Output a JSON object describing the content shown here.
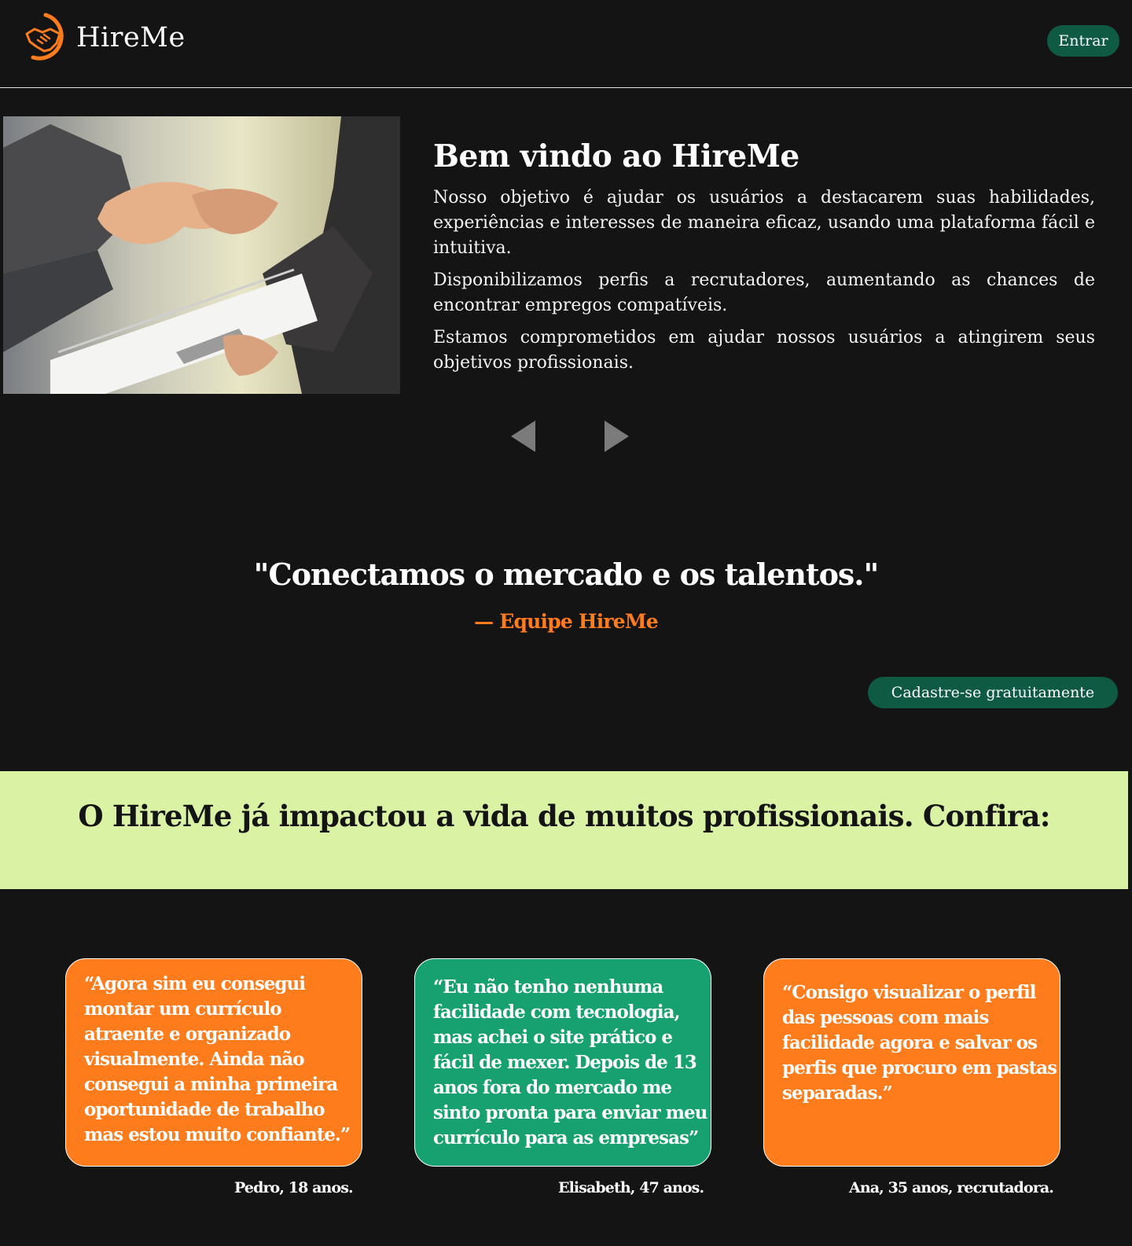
{
  "header": {
    "brand": "HireMe",
    "login_label": "Entrar"
  },
  "hero": {
    "title": "Bem vindo ao HireMe",
    "paragraphs": [
      "Nosso objetivo é ajudar os usuários a destacarem suas habilidades, experiências e interesses de maneira eficaz, usando uma plataforma fácil e intuitiva.",
      "Disponibilizamos perfis a recrutadores, aumentando as chances de encontrar empregos compatíveis.",
      "Estamos comprometidos em ajudar nossos usuários a atingirem seus objetivos profissionais."
    ]
  },
  "quote": {
    "text": "\"Conectamos o mercado e os talentos.\"",
    "author": "— Equipe HireMe"
  },
  "cta": {
    "signup_label": "Cadastre-se gratuitamente"
  },
  "impact": {
    "title": "O HireMe já impactou a vida de muitos profissionais. Confira:"
  },
  "testimonials": [
    {
      "text": "“Agora sim eu consegui montar um currículo atraente e organizado visualmente. Ainda não consegui a minha primeira oportunidade de trabalho mas estou muito confiante.”",
      "author": "Pedro, 18 anos.",
      "color": "#ff7c1c"
    },
    {
      "text": "“Eu não tenho nenhuma facilidade com tecnologia, mas achei o site prático e fácil de mexer. Depois de 13 anos fora do mercado me sinto pronta para enviar meu currículo para as empresas”",
      "author": "Elisabeth, 47 anos.",
      "color": "#17a170"
    },
    {
      "text": "“Consigo visualizar o perfil das pessoas com mais facilidade agora e salvar os perfis que procuro em pastas separadas.”",
      "author": "Ana, 35 anos, recrutadora.",
      "color": "#ff7c1c"
    }
  ],
  "icons": {
    "logo": "handshake-icon",
    "prev": "arrow-left-icon",
    "next": "arrow-right-icon"
  },
  "colors": {
    "background": "#141414",
    "accent_orange": "#ff7c1c",
    "accent_green": "#17a170",
    "button_green": "#0f5a43",
    "band": "#daf2a4"
  }
}
